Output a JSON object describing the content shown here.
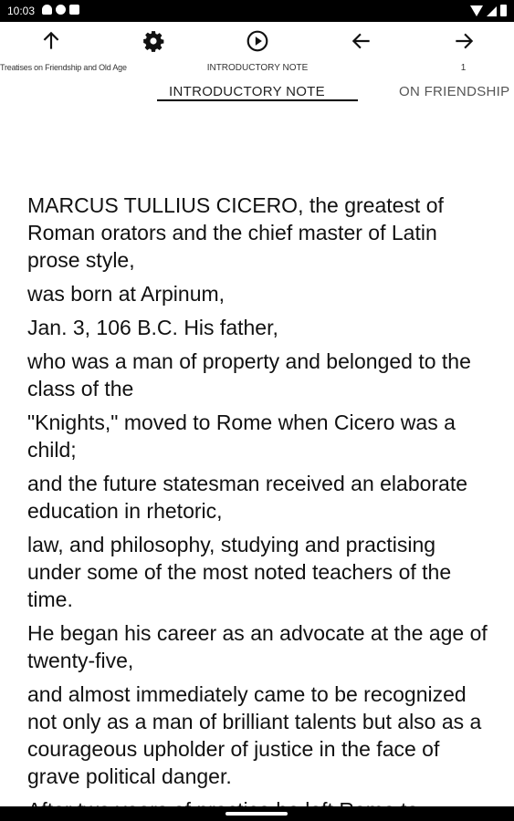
{
  "status_bar": {
    "time": "10:03"
  },
  "toolbar": {
    "book_title": "Treatises on Friendship and Old Age",
    "chapter_label": "INTRODUCTORY NOTE",
    "page_number": "1",
    "icons": [
      "arrow-up-icon",
      "gear-icon",
      "play-icon",
      "arrow-left-icon",
      "arrow-right-icon"
    ]
  },
  "tabs": [
    {
      "label": "INTRODUCTORY NOTE",
      "selected": true
    },
    {
      "label": "ON FRIENDSHIP",
      "selected": false
    }
  ],
  "content": {
    "paragraphs": [
      " MARCUS TULLIUS CICERO, the greatest of Roman orators and the chief master of Latin prose style,",
      " was born at Arpinum,",
      " Jan. 3, 106 B.C. His father,",
      " who was a man of property and belonged to the class of the",
      " \"Knights,\" moved to Rome when Cicero was a child;",
      " and the future statesman received an elaborate education in rhetoric,",
      " law, and philosophy, studying and practising under some of the most noted teachers of the time.",
      " He began his career as an advocate at the age of twenty-five,",
      " and almost immediately came to be recognized not only as a man of brilliant talents but also as a courageous upholder of justice in the face of grave political danger.",
      " After two years of practice he left Rome to"
    ]
  },
  "colors": {
    "background": "#ffffff",
    "text": "#111111",
    "bars": "#000000"
  }
}
